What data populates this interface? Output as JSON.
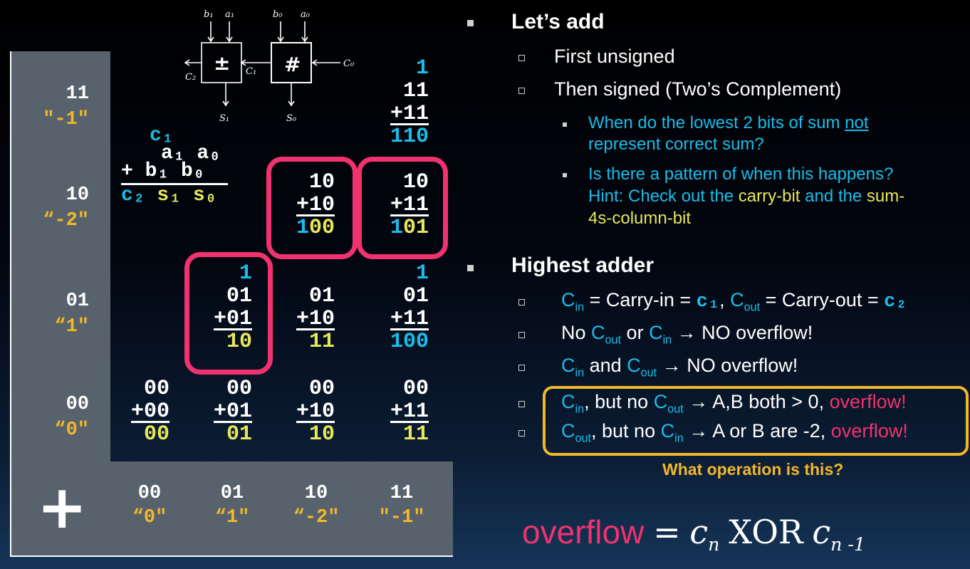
{
  "table": {
    "rows": [
      {
        "label": "11",
        "sub": "″-1″"
      },
      {
        "label": "10",
        "sub": "“-2″"
      },
      {
        "label": "01",
        "sub": "“1″"
      },
      {
        "label": "00",
        "sub": "“0″"
      }
    ],
    "cols": [
      {
        "label": "00",
        "sub": "“0″"
      },
      {
        "label": "01",
        "sub": "“1″"
      },
      {
        "label": "10",
        "sub": "“-2″"
      },
      {
        "label": "11",
        "sub": "″-1″"
      }
    ],
    "plus_symbol": "+",
    "cells": {
      "r11c11": {
        "carry": "1",
        "a": "11",
        "b": "+11",
        "sum": "110"
      },
      "r10c10": {
        "a": "10",
        "b": "+10",
        "sum": "100"
      },
      "r10c11": {
        "a": "10",
        "b": "+11",
        "sum": "101"
      },
      "r01c01": {
        "carry": "1",
        "a": "01",
        "b": "+01",
        "sum": "10"
      },
      "r01c10": {
        "a": "01",
        "b": "+10",
        "sum": "11"
      },
      "r01c11": {
        "carry": "1",
        "a": "01",
        "b": "+11",
        "sum": "100"
      },
      "r00c00": {
        "a": "00",
        "b": "+00",
        "sum": "00"
      },
      "r00c01": {
        "a": "00",
        "b": "+01",
        "sum": "01"
      },
      "r00c10": {
        "a": "00",
        "b": "+10",
        "sum": "10"
      },
      "r00c11": {
        "a": "00",
        "b": "+11",
        "sum": "11"
      }
    }
  },
  "legend": {
    "carry_in": "c₁",
    "row_a": "a₁ a₀",
    "row_b": "+ b₁ b₀",
    "row_sum_c": "c₂",
    "row_sum_s": " s₁  s₀"
  },
  "circuit": {
    "left_box": "±",
    "right_box": "#",
    "b1": "b₁",
    "a1": "a₁",
    "b0": "b₀",
    "a0": "a₀",
    "c2": "C₂",
    "c1": "C₁",
    "c0": "C₀",
    "s1": "S₁",
    "s0": "S₀"
  },
  "bullets": {
    "h1": "Let’s add",
    "first": "First unsigned",
    "then": "Then signed (Two’s Complement)",
    "q1a": "When do the lowest 2 bits of sum ",
    "q1u": "not",
    "q1b": "represent correct sum?",
    "q2a": "Is there a pattern of when this happens?",
    "q2b": "Hint: Check out the ",
    "q2c": "carry-bit",
    "q2d": " and the ",
    "q2e": "sum-",
    "q2f": "4s-column-bit",
    "h2": "Highest adder",
    "cin": "C",
    "in": "in",
    "out": "out",
    "l1_mid": " = Carry-in = ",
    "l1_c1": "c₁",
    "l1_mid2": ", ",
    "l1_mid3": " = Carry-out = ",
    "l1_c2": "c₂",
    "l2a": "No ",
    "l2b": " or ",
    "l2c": " → NO overflow!",
    "l3a": " and ",
    "l3b": " → NO overflow!",
    "l4a": ", but no ",
    "l4b": " →  A,B both > 0, ",
    "overflow": "overflow!",
    "l5a": ", but no ",
    "l5b": " → A or B are -2, ",
    "question": "What operation is this?"
  },
  "formula": {
    "word": "overflow",
    "eq": "=",
    "cn": "c",
    "n": "n",
    "xor": "XOR",
    "n1": "n -1"
  },
  "colors": {
    "pink": "#f0336e",
    "cyan": "#19bde9",
    "yellow": "#f3b82a",
    "lime": "#e6e65a",
    "gray": "#58626c"
  }
}
